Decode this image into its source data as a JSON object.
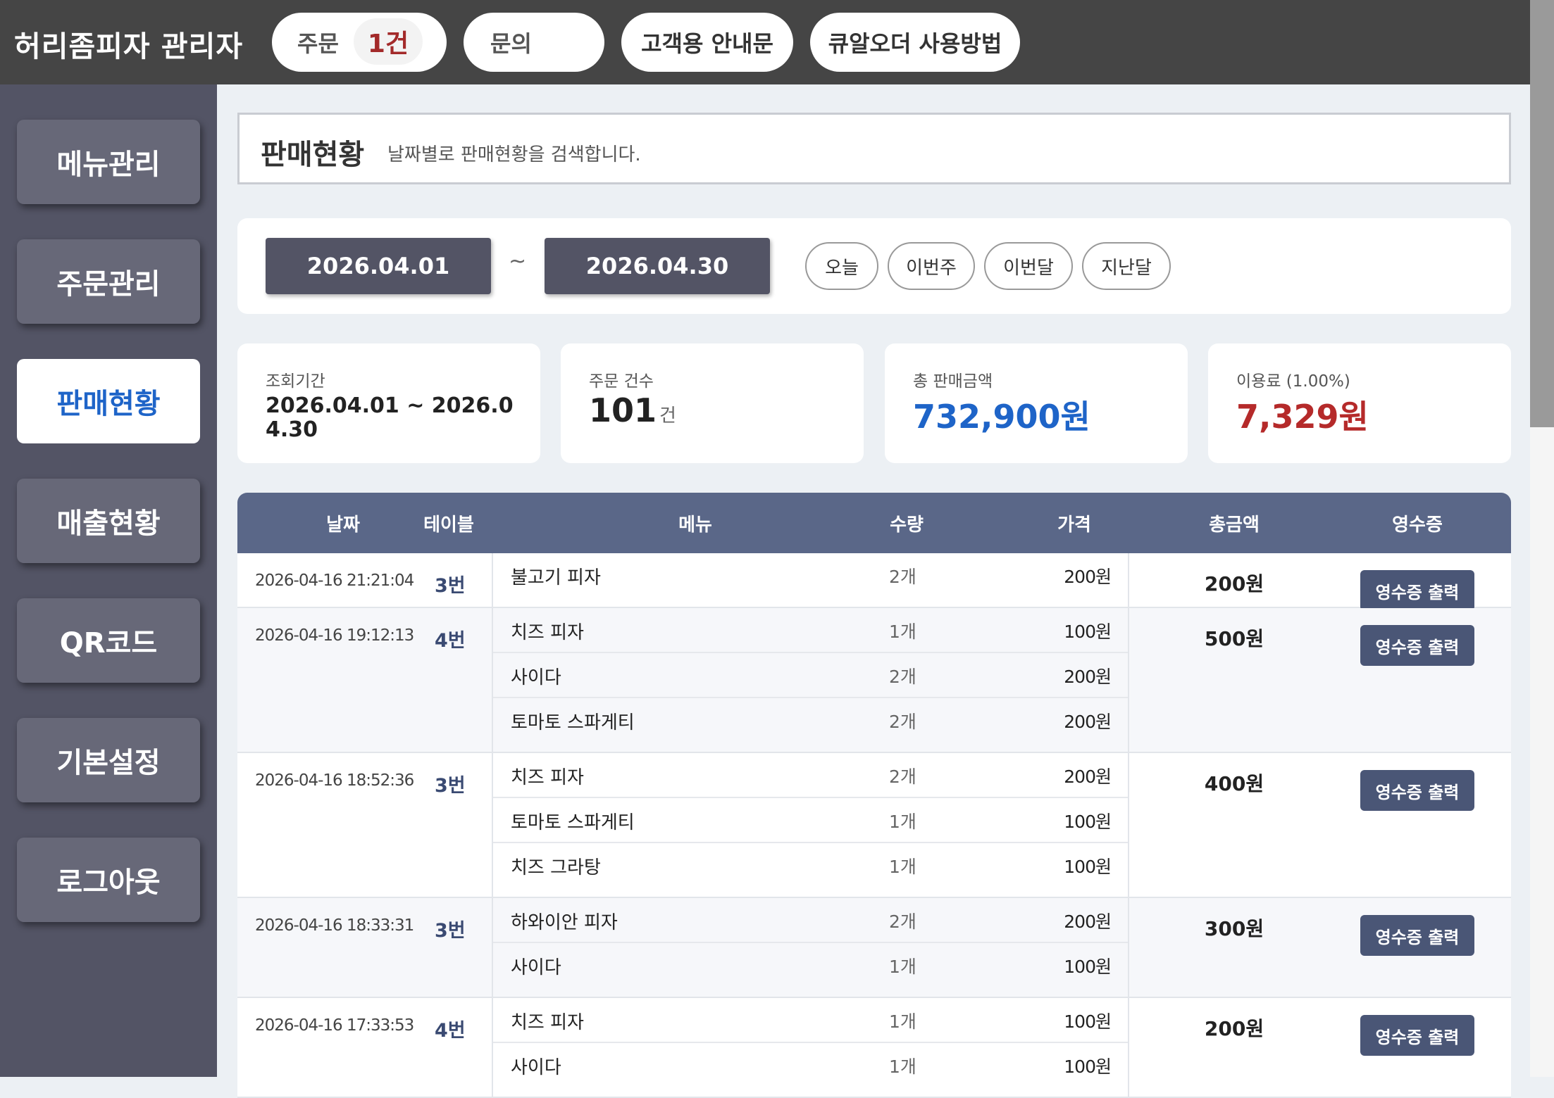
{
  "header": {
    "app_title": "허리좀피자 관리자",
    "order_label": "주문",
    "order_count": "1건",
    "inquiry_label": "문의",
    "guide_label": "고객용 안내문",
    "howto_label": "큐알오더 사용방법"
  },
  "sidebar": {
    "items": [
      {
        "label": "메뉴관리"
      },
      {
        "label": "주문관리"
      },
      {
        "label": "판매현황"
      },
      {
        "label": "매출현황"
      },
      {
        "label": "QR코드"
      },
      {
        "label": "기본설정"
      },
      {
        "label": "로그아웃"
      }
    ],
    "active": "판매현황"
  },
  "page": {
    "title": "판매현황",
    "description": "날짜별로 판매현황을 검색합니다."
  },
  "filter": {
    "start_date": "2026.04.01",
    "separator": "~",
    "end_date": "2026.04.30",
    "quick": [
      "오늘",
      "이번주",
      "이번달",
      "지난달"
    ]
  },
  "summary": {
    "period_label": "조회기간",
    "period_value": "2026.04.01 ~ 2026.04.30",
    "count_label": "주문 건수",
    "count_value": "101",
    "count_unit": "건",
    "total_label": "총 판매금액",
    "total_value": "732,900원",
    "fee_label": "이용료 (1.00%)",
    "fee_value": "7,329원"
  },
  "table": {
    "headers": {
      "date": "날짜",
      "table": "테이블",
      "menu": "메뉴",
      "qty": "수량",
      "price": "가격",
      "total": "총금액",
      "receipt": "영수증"
    },
    "receipt_label": "영수증 출력",
    "orders": [
      {
        "date": "2026-04-16 21:21:04",
        "table": "3번",
        "total": "200원",
        "items": [
          {
            "name": "불고기 피자",
            "qty": "2개",
            "price": "200원"
          }
        ]
      },
      {
        "date": "2026-04-16 19:12:13",
        "table": "4번",
        "total": "500원",
        "items": [
          {
            "name": "치즈 피자",
            "qty": "1개",
            "price": "100원"
          },
          {
            "name": "사이다",
            "qty": "2개",
            "price": "200원"
          },
          {
            "name": "토마토 스파게티",
            "qty": "2개",
            "price": "200원"
          }
        ]
      },
      {
        "date": "2026-04-16 18:52:36",
        "table": "3번",
        "total": "400원",
        "items": [
          {
            "name": "치즈 피자",
            "qty": "2개",
            "price": "200원"
          },
          {
            "name": "토마토 스파게티",
            "qty": "1개",
            "price": "100원"
          },
          {
            "name": "치즈 그라탕",
            "qty": "1개",
            "price": "100원"
          }
        ]
      },
      {
        "date": "2026-04-16 18:33:31",
        "table": "3번",
        "total": "300원",
        "items": [
          {
            "name": "하와이안 피자",
            "qty": "2개",
            "price": "200원"
          },
          {
            "name": "사이다",
            "qty": "1개",
            "price": "100원"
          }
        ]
      },
      {
        "date": "2026-04-16 17:33:53",
        "table": "4번",
        "total": "200원",
        "items": [
          {
            "name": "치즈 피자",
            "qty": "1개",
            "price": "100원"
          },
          {
            "name": "사이다",
            "qty": "1개",
            "price": "100원"
          }
        ]
      }
    ]
  }
}
